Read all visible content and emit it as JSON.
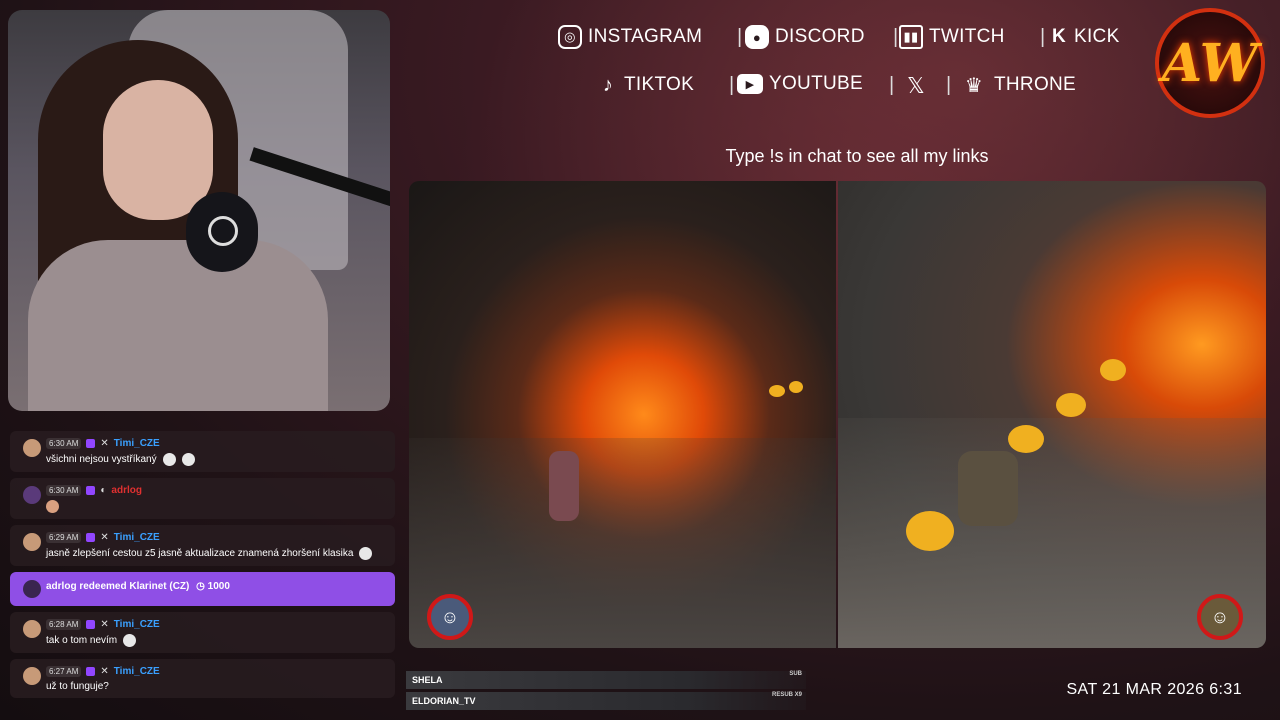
{
  "socials": {
    "instagram": "INSTAGRAM",
    "discord": "DISCORD",
    "twitch": "TWITCH",
    "kick": "KICK",
    "tiktok": "TIKTOK",
    "youtube": "YOUTUBE",
    "x": "𝕏",
    "throne": "THRONE"
  },
  "logo": "AW",
  "link_hint": "Type !s in chat to see all my links",
  "chat": [
    {
      "time": "6:30 AM",
      "user": "Timi_CZE",
      "text": "všichni nejsou vystříkaný"
    },
    {
      "time": "6:30 AM",
      "user": "adrlog",
      "text": ""
    },
    {
      "time": "6:29 AM",
      "user": "Timi_CZE",
      "text": "jasně zlepšení cestou z5 jasně aktualizace znamená zhoršení klasika"
    },
    {
      "time": "6:28 AM",
      "user": "Timi_CZE",
      "text": "tak o tom nevím"
    },
    {
      "time": "6:27 AM",
      "user": "Timi_CZE",
      "text": "už to funguje?"
    }
  ],
  "redeem": {
    "text": "adrlog redeemed Klarinet (CZ)",
    "points": "1000"
  },
  "event_bars": [
    {
      "name": "SHELA",
      "tag": "SUB"
    },
    {
      "name": "ELDORIAN_TV",
      "tag": "RESUB X9"
    }
  ],
  "datetime": "SAT 21 MAR 2026 6:31",
  "colors": {
    "accent": "#8f4fe6",
    "username_blue": "#3aa0ff",
    "username_red": "#e03030",
    "logo_ring": "#d23010"
  }
}
